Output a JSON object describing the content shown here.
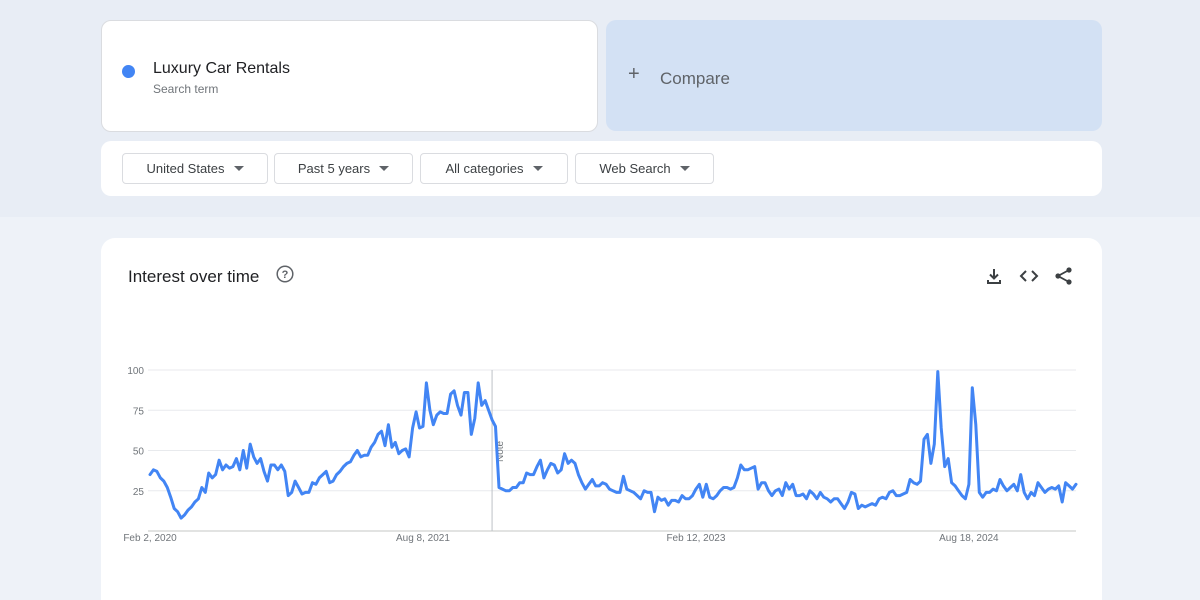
{
  "search_term": {
    "name": "Luxury Car Rentals",
    "subtitle": "Search term",
    "color": "#4285f4"
  },
  "compare": {
    "plus": "+",
    "label": "Compare"
  },
  "filters": [
    {
      "label": "United States"
    },
    {
      "label": "Past 5 years"
    },
    {
      "label": "All categories"
    },
    {
      "label": "Web Search"
    }
  ],
  "chart_section": {
    "title": "Interest over time",
    "icons": [
      "help-icon",
      "download-icon",
      "embed-icon",
      "share-icon"
    ]
  },
  "chart_data": {
    "type": "line",
    "title": "Interest over time",
    "ylim": [
      0,
      100
    ],
    "y_ticks": [
      25,
      50,
      75,
      100
    ],
    "x_tick_labels": [
      "Feb 2, 2020",
      "Aug 8, 2021",
      "Feb 12, 2023",
      "Aug 18, 2024"
    ],
    "x_tick_index": [
      0,
      79,
      158,
      237
    ],
    "annotation": {
      "text": "Note",
      "index": 99
    },
    "grid": true,
    "line_color": "#4285f4",
    "series": [
      {
        "values": [
          35,
          38,
          37,
          33,
          31,
          27,
          21,
          14,
          12,
          8,
          10,
          13,
          15,
          18,
          20,
          27,
          24,
          36,
          33,
          35,
          44,
          38,
          41,
          39,
          40,
          45,
          38,
          50,
          39,
          54,
          46,
          42,
          45,
          37,
          31,
          41,
          41,
          38,
          41,
          37,
          22,
          24,
          31,
          27,
          23,
          24,
          24,
          30,
          29,
          33,
          35,
          37,
          30,
          31,
          35,
          37,
          40,
          42,
          43,
          47,
          50,
          46,
          47,
          47,
          52,
          55,
          60,
          62,
          53,
          66,
          52,
          55,
          48,
          50,
          51,
          46,
          64,
          74,
          64,
          65,
          92,
          75,
          66,
          72,
          74,
          73,
          73,
          85,
          87,
          78,
          72,
          86,
          86,
          60,
          70,
          92,
          78,
          81,
          75,
          69,
          65,
          27,
          26,
          25,
          25,
          27,
          27,
          30,
          30,
          36,
          35,
          35,
          40,
          44,
          33,
          38,
          42,
          41,
          36,
          38,
          48,
          42,
          44,
          42,
          35,
          30,
          26,
          29,
          32,
          28,
          28,
          30,
          29,
          26,
          25,
          24,
          24,
          34,
          26,
          25,
          24,
          22,
          20,
          25,
          24,
          24,
          12,
          21,
          19,
          20,
          16,
          19,
          19,
          18,
          22,
          20,
          20,
          22,
          26,
          29,
          21,
          29,
          21,
          20,
          22,
          25,
          27,
          27,
          26,
          27,
          33,
          41,
          38,
          38,
          39,
          40,
          26,
          30,
          30,
          25,
          22,
          25,
          26,
          22,
          30,
          26,
          29,
          22,
          22,
          23,
          20,
          25,
          23,
          20,
          24,
          21,
          20,
          18,
          20,
          20,
          17,
          14,
          18,
          24,
          23,
          14,
          16,
          15,
          16,
          17,
          16,
          20,
          21,
          20,
          24,
          25,
          22,
          22,
          23,
          24,
          32,
          30,
          29,
          31,
          57,
          60,
          42,
          54,
          99,
          64,
          40,
          45,
          30,
          28,
          25,
          22,
          20,
          29,
          89,
          66,
          24,
          21,
          24,
          24,
          26,
          25,
          32,
          28,
          25,
          27,
          29,
          25,
          35,
          24,
          20,
          24,
          22,
          30,
          27,
          24,
          26,
          27,
          26,
          28,
          18,
          30,
          28,
          26,
          29
        ]
      }
    ]
  }
}
